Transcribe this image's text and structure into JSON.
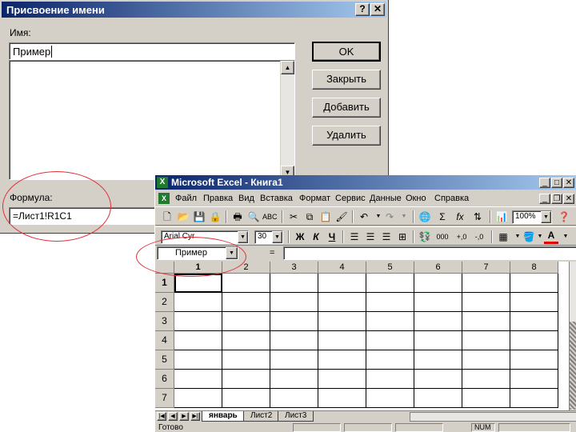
{
  "dialog": {
    "title": "Присвоение имени",
    "help_btn": "?",
    "close_btn": "✕",
    "name_label": "Имя:",
    "name_value": "Пример",
    "buttons": {
      "ok": "OK",
      "close": "Закрыть",
      "add": "Добавить",
      "delete": "Удалить"
    },
    "formula_label": "Формула:",
    "formula_value": "=Лист1!R1C1"
  },
  "excel": {
    "title": "Microsoft Excel - Книга1",
    "logo": "X",
    "menu": [
      "Файл",
      "Правка",
      "Вид",
      "Вставка",
      "Формат",
      "Сервис",
      "Данные",
      "Окно",
      "Справка"
    ],
    "zoom": "100%",
    "font": "Arial Cyr",
    "font_size": "30",
    "name_box": "Пример",
    "formula_eq": "=",
    "columns": [
      "1",
      "2",
      "3",
      "4",
      "5",
      "6",
      "7",
      "8"
    ],
    "rows": [
      "1",
      "2",
      "3",
      "4",
      "5",
      "6",
      "7"
    ],
    "sheets": [
      "январь",
      "Лист2",
      "Лист3"
    ],
    "status": "Готово",
    "status_num": "NUM",
    "tb_bold": "Ж",
    "tb_italic": "К",
    "tb_underline": "Ч",
    "tb_thousands": "000"
  },
  "colors": {
    "titlebar": "#0a246a",
    "face": "#d4d0c8",
    "annotation": "#e0303a"
  }
}
